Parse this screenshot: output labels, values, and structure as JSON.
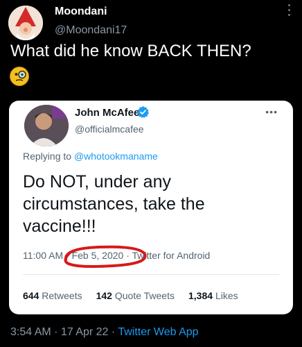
{
  "outer_tweet": {
    "display_name": "Moondani",
    "handle": "@Moondani17",
    "text": "What did he know BACK THEN?",
    "emoji_icon": "monocle-face-emoji",
    "timestamp": "3:54 AM · 17 Apr 22 · ",
    "source_app": "Twitter Web App"
  },
  "quoted_tweet": {
    "display_name": "John McAfee",
    "handle": "@officialmcafee",
    "reply_prefix": "Replying to ",
    "reply_mention": "@whotookmaname",
    "text": "Do NOT, under any circumstances, take the vaccine!!!",
    "time": "11:00 AM",
    "date": "Feb 5, 2020",
    "source_app": "Twitter for Android",
    "more_label": "•••",
    "stats": {
      "retweets_count": "644",
      "retweets_label": "Retweets",
      "quote_count": "142",
      "quote_label": "Quote Tweets",
      "likes_count": "1,384",
      "likes_label": "Likes"
    }
  },
  "colors": {
    "background": "#000000",
    "card": "#ffffff",
    "link_blue": "#1d9bf0",
    "muted_gray": "#8b98a5",
    "annotation_red": "#d61a1a"
  }
}
